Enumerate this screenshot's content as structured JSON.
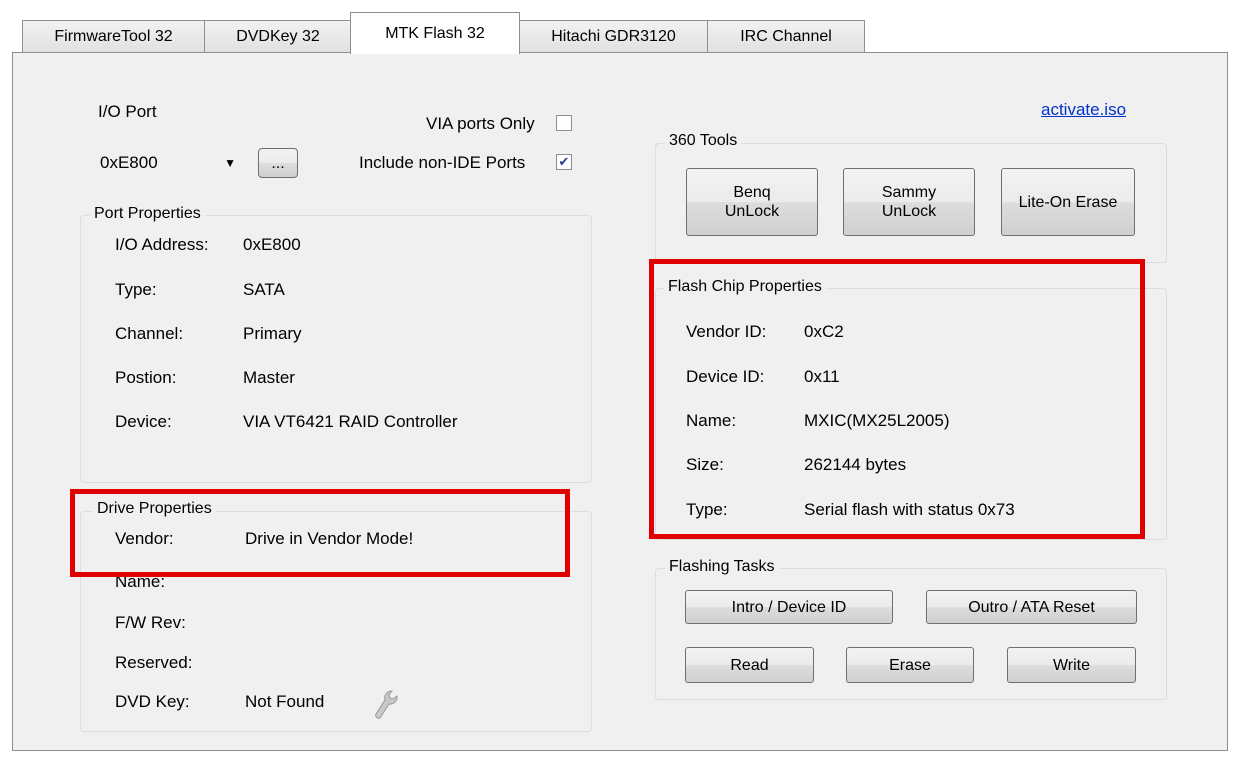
{
  "tabs": [
    "FirmwareTool 32",
    "DVDKey 32",
    "MTK Flash 32",
    "Hitachi GDR3120",
    "IRC Channel"
  ],
  "io_port": {
    "label": "I/O Port",
    "selected": "0xE800",
    "browse_label": "...",
    "via_only_label": "VIA ports Only",
    "via_only_checked": false,
    "non_ide_label": "Include non-IDE Ports",
    "non_ide_checked": true
  },
  "port_properties": {
    "title": "Port Properties",
    "rows": [
      {
        "label": "I/O Address:",
        "value": "0xE800"
      },
      {
        "label": "Type:",
        "value": "SATA"
      },
      {
        "label": "Channel:",
        "value": "Primary"
      },
      {
        "label": "Postion:",
        "value": "Master"
      },
      {
        "label": "Device:",
        "value": "VIA VT6421 RAID Controller"
      }
    ]
  },
  "drive_properties": {
    "title": "Drive Properties",
    "rows": [
      {
        "label": "Vendor:",
        "value": "Drive in Vendor Mode!"
      },
      {
        "label": "Name:",
        "value": ""
      },
      {
        "label": "F/W Rev:",
        "value": ""
      },
      {
        "label": "Reserved:",
        "value": ""
      },
      {
        "label": "DVD Key:",
        "value": "Not Found"
      }
    ]
  },
  "activate_link": "activate.iso",
  "tools_360": {
    "title": "360 Tools",
    "buttons": [
      "Benq\nUnLock",
      "Sammy\nUnLock",
      "Lite-On Erase"
    ]
  },
  "flash_chip": {
    "title": "Flash Chip Properties",
    "rows": [
      {
        "label": "Vendor ID:",
        "value": "0xC2"
      },
      {
        "label": "Device ID:",
        "value": "0x11"
      },
      {
        "label": "Name:",
        "value": "MXIC(MX25L2005)"
      },
      {
        "label": "Size:",
        "value": "262144 bytes"
      },
      {
        "label": "Type:",
        "value": "Serial flash with status 0x73"
      }
    ]
  },
  "flashing_tasks": {
    "title": "Flashing Tasks",
    "intro_label": "Intro / Device ID",
    "outro_label": "Outro / ATA Reset",
    "read_label": "Read",
    "erase_label": "Erase",
    "write_label": "Write"
  },
  "colors": {
    "highlight": "#e00000",
    "link": "#0033cc"
  }
}
